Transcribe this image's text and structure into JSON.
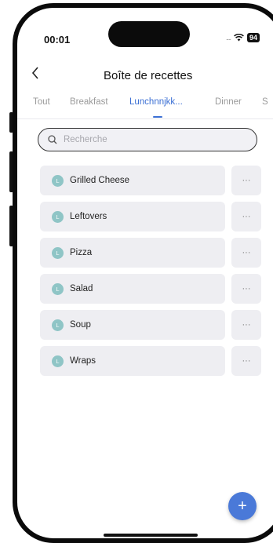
{
  "status_bar": {
    "time": "00:01",
    "signal": "....",
    "wifi_icon": "wifi-icon",
    "battery": "94"
  },
  "header": {
    "back_icon": "chevron-left-icon",
    "title": "Boîte de recettes"
  },
  "tabs": [
    {
      "label": "Tout",
      "active": false
    },
    {
      "label": "Breakfast",
      "active": false
    },
    {
      "label": "Lunchnnjkk...",
      "active": true
    },
    {
      "label": "Dinner",
      "active": false
    },
    {
      "label": "S",
      "active": false
    }
  ],
  "search": {
    "placeholder": "Recherche",
    "icon": "search-icon"
  },
  "recipes": [
    {
      "badge": "L",
      "name": "Grilled Cheese",
      "more": "···"
    },
    {
      "badge": "L",
      "name": "Leftovers",
      "more": "···"
    },
    {
      "badge": "L",
      "name": "Pizza",
      "more": "···"
    },
    {
      "badge": "L",
      "name": "Salad",
      "more": "···"
    },
    {
      "badge": "L",
      "name": "Soup",
      "more": "···"
    },
    {
      "badge": "L",
      "name": "Wraps",
      "more": "···"
    }
  ],
  "fab": {
    "label": "+",
    "icon": "plus-icon"
  },
  "colors": {
    "accent": "#3b6fd4",
    "fab": "#4a79d8",
    "badge": "#8fc5c6",
    "row_bg": "#eeeef2"
  }
}
